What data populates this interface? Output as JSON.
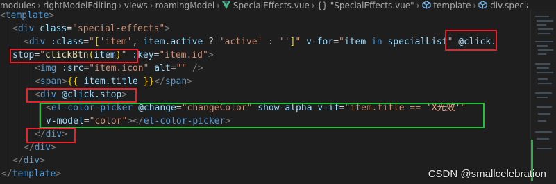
{
  "breadcrumb": {
    "items": [
      "modules",
      "rightModelEditing",
      "views",
      "roamingModel",
      "SpecialEffects.vue",
      "{} \"SpecialEffects.vue\"",
      "template",
      "div.special-effe"
    ]
  },
  "code": {
    "l1": {
      "open": "<",
      "tag": "template",
      "close": ">"
    },
    "l2": {
      "open": "<",
      "tag": "div",
      "a1": "class",
      "eq": "=",
      "v1": "\"special-effects\"",
      "close": ">"
    },
    "l3": {
      "open": "<",
      "tag": "div",
      "a1": ":class",
      "eq": "=",
      "q": "\"",
      "b1": "[",
      "s1": "'item'",
      "comma": ", ",
      "id1": "item",
      "dot": ".",
      "id2": "active",
      "tern1": " ? ",
      "s2": "'active'",
      "tern2": " : ",
      "s3": "''",
      "b2": "]",
      "q2": "\"",
      "a2": "v-for",
      "v2q1": "\"",
      "id3": "item",
      "in": " in ",
      "id4": "specialList",
      "v2q2": "\"",
      "a3": "@click."
    },
    "l4": {
      "a3b": "stop",
      "eq": "=",
      "q": "\"",
      "fn": "clickBtn",
      "p1": "(",
      "arg": "item",
      "p2": ")",
      "q2": "\"",
      "a4": ":key",
      "v4": "\"item.id\"",
      "close": ">"
    },
    "l5": {
      "open": "<",
      "tag": "img",
      "a1": ":src",
      "eq": "=",
      "v1": "\"item.icon\"",
      "a2": "alt",
      "v2": "\"\"",
      "close": " />"
    },
    "l6": {
      "open": "<",
      "tag": "span",
      "gt": ">",
      "m1": "{{",
      "expr": " item.title ",
      "m2": "}}",
      "closeopen": "</",
      "ctag": "span",
      "close": ">"
    },
    "l7": {
      "open": "<",
      "tag": "div",
      "a1": "@click.stop",
      "close": ">"
    },
    "l8": {
      "open": "<",
      "tag": "el-color-picker",
      "a1": "@change",
      "eq": "=",
      "v1": "\"changeColor\"",
      "a2": "show-alpha",
      "a3": "v-if",
      "v3a": "\"item.title == ",
      "v3b": "'X光效'",
      "v3c": "\""
    },
    "l9": {
      "a1": "v-model",
      "eq": "=",
      "v1": "\"color\"",
      "gt": ">",
      "closeopen": "</",
      "ctag": "el-color-picker",
      "close": ">"
    },
    "l10": {
      "open": "</",
      "tag": "div",
      "close": ">"
    },
    "l11": {
      "open": "</",
      "tag": "div",
      "close": ">"
    },
    "l12": {
      "open": "</",
      "tag": "div",
      "close": ">"
    },
    "l13": {
      "open": "</",
      "tag": "template",
      "close": ">"
    }
  },
  "watermark": "CSDN @smallcelebration",
  "colors": {
    "highlight_red": "#e8212b",
    "highlight_green": "#23c23a",
    "background": "#1e1e1e"
  },
  "icons": {
    "vue_file": "vue-file-icon",
    "braces": "braces-icon",
    "template": "template-cube-icon",
    "element": "element-cube-icon"
  }
}
